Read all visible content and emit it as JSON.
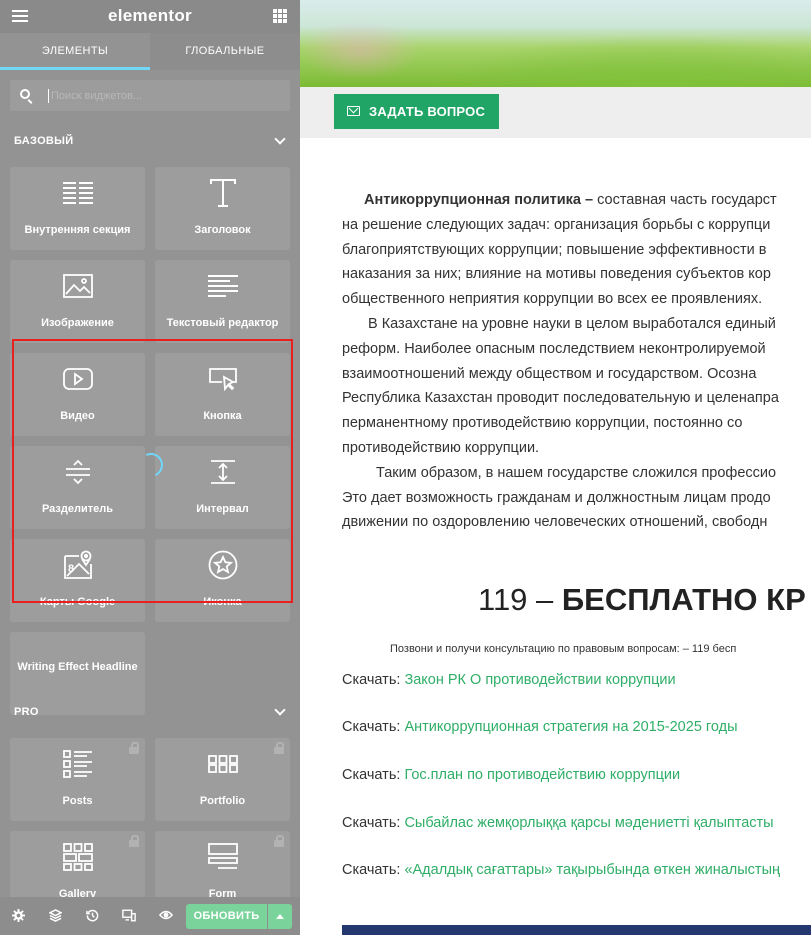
{
  "panel": {
    "logo": "elementor",
    "tabs": [
      "ЭЛЕМЕНТЫ",
      "ГЛОБАЛЬНЫЕ"
    ],
    "search_placeholder": "Поиск виджетов...",
    "categories": {
      "basic": "БАЗОВЫЙ",
      "pro": "PRO"
    },
    "widgets": [
      {
        "label": "Внутренняя секция",
        "icon": "inner-section-icon"
      },
      {
        "label": "Заголовок",
        "icon": "heading-icon"
      },
      {
        "label": "Изображение",
        "icon": "image-icon"
      },
      {
        "label": "Текстовый редактор",
        "icon": "text-editor-icon"
      },
      {
        "label": "Видео",
        "icon": "video-icon"
      },
      {
        "label": "Кнопка",
        "icon": "button-icon"
      },
      {
        "label": "Разделитель",
        "icon": "divider-icon"
      },
      {
        "label": "Интервал",
        "icon": "spacer-icon"
      },
      {
        "label": "Карты Google",
        "icon": "google-maps-icon"
      },
      {
        "label": "Иконка",
        "icon": "star-icon"
      },
      {
        "label": "Writing Effect Headline",
        "icon": ""
      }
    ],
    "pro_widgets": [
      {
        "label": "Posts",
        "icon": "posts-icon"
      },
      {
        "label": "Portfolio",
        "icon": "portfolio-icon"
      },
      {
        "label": "Gallery",
        "icon": "gallery-icon"
      },
      {
        "label": "Form",
        "icon": "form-icon"
      }
    ],
    "footer": {
      "update_label": "ОБНОВИТЬ"
    }
  },
  "preview": {
    "ask_button": "ЗАДАТЬ ВОПРОС",
    "article_lead_bold": "Антикоррупционная политика –",
    "article_lines": [
      " составная часть государст",
      "на решение следующих задач: организация борьбы с коррупци",
      "благоприятствующих коррупции; повышение эффективности  в",
      "наказания за них; влияние на мотивы поведения субъектов кор",
      "общественного неприятия коррупции во всех ее проявлениях.",
      "В Казахстане на уровне науки в целом выработался единый",
      "реформ. Наиболее опасным последствием неконтролируемой",
      "взаимоотношений между обществом и государством.    Осозна",
      "Республика Казахстан проводит последовательную и целенапра",
      "перманентному противодействию коррупции,      постоянно со",
      "противодействию коррупции.",
      "Таким образом, в нашем государстве сложился профессио",
      "Это дает возможность гражданам и должностным лицам продо",
      "движении по оздоровлению человеческих отношений, свободн"
    ],
    "title_number": "119 – ",
    "title_bold": "БЕСПЛАТНО КР",
    "consult_text": "Позвони и получи консультацию по правовым вопросам: – 119 бесп",
    "download_prefix": "Скачать: ",
    "downloads": [
      "Закон РК О противодействии коррупции",
      "Антикоррупционная стратегия на 2015-2025 годы",
      "Гос.план по противодействию коррупции",
      "Сыбайлас жемқорлыққа қарсы мәдениетті қалыптасты",
      "«Адалдық сағаттары» тақырыбында өткен жиналыстың"
    ]
  },
  "colors": {
    "panel_bg": "#939393",
    "tab_accent": "#71d7f7",
    "update_button": "#79d39b",
    "ask_button": "#21a567",
    "link": "#2fae67",
    "highlight": "#e82020"
  }
}
